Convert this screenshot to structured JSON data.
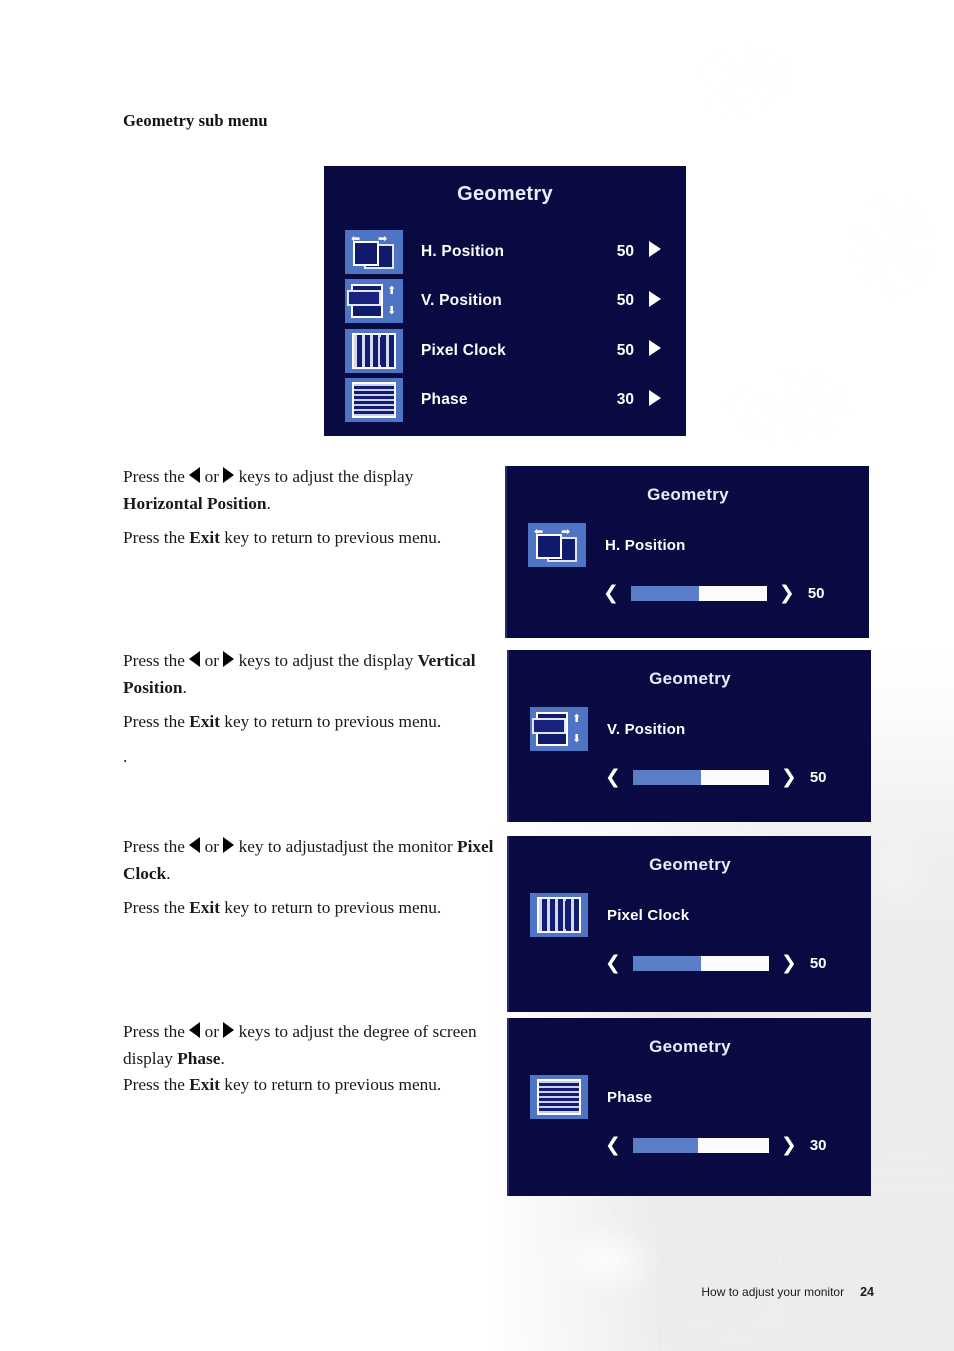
{
  "page": {
    "heading": "Geometry sub menu",
    "footer_text": "How to adjust your monitor",
    "footer_page": "24"
  },
  "colors": {
    "osd_background": "#0a0a42",
    "osd_text": "#ffffff",
    "icon_tile": "#4f74c4",
    "slider_fill": "#5a7fc8",
    "slider_track": "#fbfbfd"
  },
  "main_menu": {
    "title": "Geometry",
    "rows": [
      {
        "icon": "h-position-icon",
        "label": "H. Position",
        "value": "50",
        "arrow": "triangle-right-icon"
      },
      {
        "icon": "v-position-icon",
        "label": "V. Position",
        "value": "50",
        "arrow": "triangle-right-icon"
      },
      {
        "icon": "pixel-clock-icon",
        "label": "Pixel Clock",
        "value": "50",
        "arrow": "triangle-right-icon"
      },
      {
        "icon": "phase-icon",
        "label": "Phase",
        "value": "30",
        "arrow": "triangle-right-icon"
      }
    ]
  },
  "sections": [
    {
      "instruction_prefix": "Press the ",
      "instruction_or": " or ",
      "instruction_mid": " keys to adjust the display ",
      "instruction_bold": "Horizontal Position",
      "instruction_suffix": ".",
      "exit_prefix": "Press the ",
      "exit_bold": "Exit",
      "exit_suffix": " key to return to previous menu.",
      "trailing": "",
      "osd": {
        "title": "Geometry",
        "icon": "h-position-icon",
        "label": "H. Position",
        "left_chevron": "chevron-left-icon",
        "right_chevron": "chevron-right-icon",
        "value": "50",
        "fill_percent": 50
      }
    },
    {
      "instruction_prefix": "Press the ",
      "instruction_or": " or ",
      "instruction_mid": " keys to adjust the display ",
      "instruction_bold": "Vertical Position",
      "instruction_suffix": ".",
      "exit_prefix": "Press the ",
      "exit_bold": "Exit",
      "exit_suffix": " key to return to previous menu.",
      "trailing": ".",
      "osd": {
        "title": "Geometry",
        "icon": "v-position-icon",
        "label": "V. Position",
        "left_chevron": "chevron-left-icon",
        "right_chevron": "chevron-right-icon",
        "value": "50",
        "fill_percent": 50
      }
    },
    {
      "instruction_prefix": "Press the ",
      "instruction_or": " or ",
      "instruction_mid": " key to adjustadjust the monitor ",
      "instruction_bold": "Pixel Clock",
      "instruction_suffix": ".",
      "exit_prefix": "Press the ",
      "exit_bold": "Exit",
      "exit_suffix": " key to return to previous menu.",
      "trailing": "",
      "osd": {
        "title": "Geometry",
        "icon": "pixel-clock-icon",
        "label": "Pixel Clock",
        "left_chevron": "chevron-left-icon",
        "right_chevron": "chevron-right-icon",
        "value": "50",
        "fill_percent": 50
      }
    },
    {
      "instruction_prefix": "Press the ",
      "instruction_or": " or ",
      "instruction_mid": "  keys to adjust the degree of screen display ",
      "instruction_bold": "Phase",
      "instruction_suffix": ".",
      "exit_prefix": "Press the ",
      "exit_bold": "Exit",
      "exit_suffix": " key to return to previous menu.",
      "trailing": "",
      "osd": {
        "title": "Geometry",
        "icon": "phase-icon",
        "label": "Phase",
        "left_chevron": "chevron-left-icon",
        "right_chevron": "chevron-right-icon",
        "value": "30",
        "fill_percent": 48
      }
    }
  ]
}
